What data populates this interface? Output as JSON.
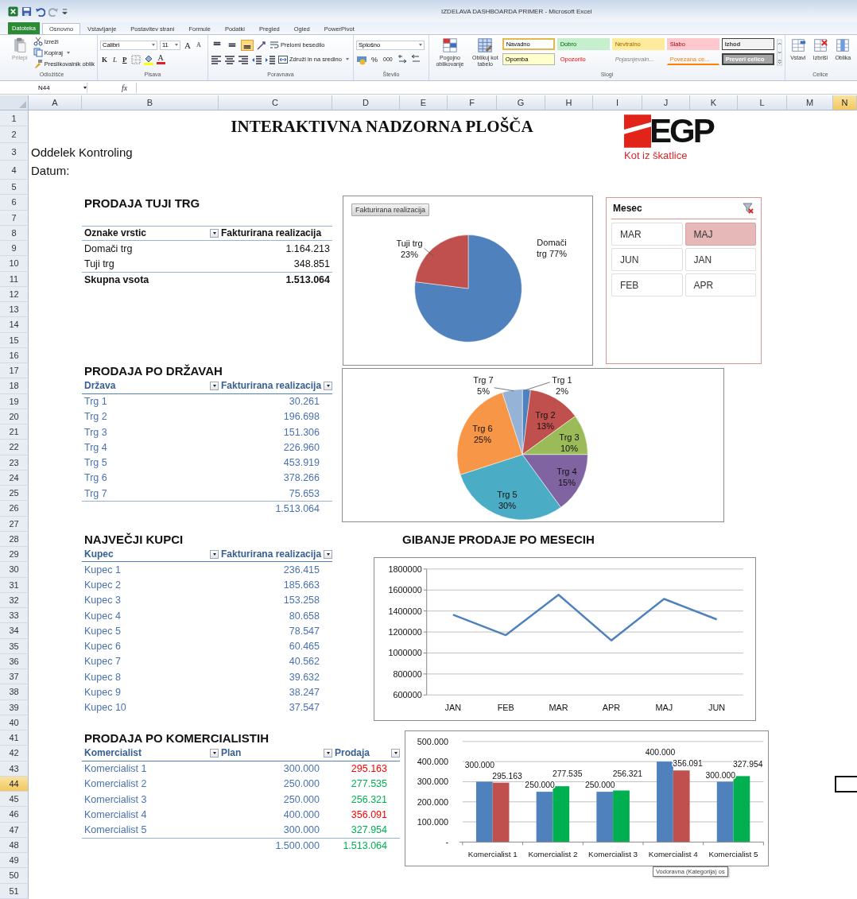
{
  "window": {
    "title": "IZDELAVA DASHBOARDA PRIMER - Microsoft Excel"
  },
  "file_tab": "Datoteka",
  "tabs": [
    {
      "label": "Osnovno",
      "selected": true
    },
    {
      "label": "Vstavljanje",
      "selected": false
    },
    {
      "label": "Postavitev strani",
      "selected": false
    },
    {
      "label": "Formule",
      "selected": false
    },
    {
      "label": "Podatki",
      "selected": false
    },
    {
      "label": "Pregled",
      "selected": false
    },
    {
      "label": "Ogled",
      "selected": false
    },
    {
      "label": "PowerPivot",
      "selected": false
    }
  ],
  "ribbon": {
    "clipboard": {
      "paste": "Prilepi",
      "cut": "Izreži",
      "copy": "Kopiraj",
      "format_painter": "Preslikovalnik oblik",
      "label": "Odložišče"
    },
    "font": {
      "family": "Calibri",
      "size": "11",
      "grow": "A",
      "shrink": "A",
      "bold": "K",
      "italic": "L",
      "underline": "P",
      "color_button": "A",
      "label": "Pisava"
    },
    "alignment": {
      "vertical": [
        {
          "selected": false
        },
        {
          "selected": false
        },
        {
          "selected": true
        }
      ],
      "wrap": "Prelomi besedilo",
      "merge": "Združi in na sredino",
      "label": "Poravnava"
    },
    "number": {
      "format": "Splošno",
      "percent": "%",
      "thousands": "000",
      "label": "Število"
    },
    "styles": {
      "conditional": "Pogojno oblikovanje",
      "as_table": "Oblikuj kot tabelo",
      "label": "Slogi",
      "cell_styles": [
        {
          "label": "Navadno",
          "kind": "normal",
          "selected": true
        },
        {
          "label": "Dobro",
          "kind": "good",
          "selected": false
        },
        {
          "label": "Nevtralno",
          "kind": "neutral",
          "selected": false
        },
        {
          "label": "Slabo",
          "kind": "bad",
          "selected": false
        },
        {
          "label": "Izhod",
          "kind": "output",
          "selected": false
        },
        {
          "label": "Opomba",
          "kind": "note",
          "selected": false
        },
        {
          "label": "Opozorilo",
          "kind": "warning",
          "selected": false
        },
        {
          "label": "Pojasnjevaln...",
          "kind": "explanatory",
          "selected": false
        },
        {
          "label": "Povezana ce...",
          "kind": "linked",
          "selected": false
        },
        {
          "label": "Preveri celico",
          "kind": "check",
          "selected": false
        }
      ]
    },
    "cells": {
      "buttons": [
        "Vstavi",
        "Izbriši",
        "Oblika"
      ],
      "label": "Celice"
    }
  },
  "formula_bar": {
    "name_box": "N44",
    "function_label": "fx"
  },
  "sheet": {
    "columns": [
      {
        "label": "A",
        "selected": false
      },
      {
        "label": "B",
        "selected": false
      },
      {
        "label": "C",
        "selected": false
      },
      {
        "label": "D",
        "selected": false
      },
      {
        "label": "E",
        "selected": false
      },
      {
        "label": "F",
        "selected": false
      },
      {
        "label": "G",
        "selected": false
      },
      {
        "label": "H",
        "selected": false
      },
      {
        "label": "I",
        "selected": false
      },
      {
        "label": "J",
        "selected": false
      },
      {
        "label": "K",
        "selected": false
      },
      {
        "label": "L",
        "selected": false
      },
      {
        "label": "M",
        "selected": false
      },
      {
        "label": "N",
        "selected": true
      }
    ],
    "row_headers": [
      {
        "label": "1",
        "selected": false
      },
      {
        "label": "2",
        "selected": false
      },
      {
        "label": "3",
        "selected": false
      },
      {
        "label": "4",
        "selected": false
      },
      {
        "label": "5",
        "selected": false
      },
      {
        "label": "6",
        "selected": false
      },
      {
        "label": "7",
        "selected": false
      },
      {
        "label": "8",
        "selected": false
      },
      {
        "label": "9",
        "selected": false
      },
      {
        "label": "10",
        "selected": false
      },
      {
        "label": "11",
        "selected": false
      },
      {
        "label": "12",
        "selected": false
      },
      {
        "label": "13",
        "selected": false
      },
      {
        "label": "14",
        "selected": false
      },
      {
        "label": "15",
        "selected": false
      },
      {
        "label": "16",
        "selected": false
      },
      {
        "label": "17",
        "selected": false
      },
      {
        "label": "18",
        "selected": false
      },
      {
        "label": "19",
        "selected": false
      },
      {
        "label": "20",
        "selected": false
      },
      {
        "label": "21",
        "selected": false
      },
      {
        "label": "22",
        "selected": false
      },
      {
        "label": "23",
        "selected": false
      },
      {
        "label": "24",
        "selected": false
      },
      {
        "label": "25",
        "selected": false
      },
      {
        "label": "26",
        "selected": false
      },
      {
        "label": "27",
        "selected": false
      },
      {
        "label": "28",
        "selected": false
      },
      {
        "label": "29",
        "selected": false
      },
      {
        "label": "30",
        "selected": false
      },
      {
        "label": "31",
        "selected": false
      },
      {
        "label": "32",
        "selected": false
      },
      {
        "label": "33",
        "selected": false
      },
      {
        "label": "34",
        "selected": false
      },
      {
        "label": "35",
        "selected": false
      },
      {
        "label": "36",
        "selected": false
      },
      {
        "label": "37",
        "selected": false
      },
      {
        "label": "38",
        "selected": false
      },
      {
        "label": "39",
        "selected": false
      },
      {
        "label": "40",
        "selected": false
      },
      {
        "label": "41",
        "selected": false
      },
      {
        "label": "42",
        "selected": false
      },
      {
        "label": "43",
        "selected": false
      },
      {
        "label": "44",
        "selected": true
      },
      {
        "label": "45",
        "selected": false
      },
      {
        "label": "46",
        "selected": false
      },
      {
        "label": "47",
        "selected": false
      },
      {
        "label": "48",
        "selected": false
      },
      {
        "label": "49",
        "selected": false
      },
      {
        "label": "50",
        "selected": false
      },
      {
        "label": "51",
        "selected": false
      }
    ],
    "title": "INTERAKTIVNA NADZORNA PLOŠČA",
    "department": "Oddelek Kontroling",
    "date_label": "Datum:",
    "logo": {
      "name": "EGP",
      "tagline": "Kot iz škatlice"
    },
    "tables": [
      {
        "kind": "pivot",
        "heading": "PRODAJA TUJI TRG",
        "columns": [
          {
            "label": "Oznake vrstic",
            "filter": true
          },
          {
            "label": "Fakturirana realizacija",
            "filter": false
          }
        ],
        "rows": [
          {
            "cells": [
              "Domači trg",
              "1.164.213"
            ]
          },
          {
            "cells": [
              "Tuji trg",
              "348.851"
            ]
          }
        ],
        "total": {
          "label": "Skupna vsota",
          "values": [
            "1.513.064"
          ]
        }
      },
      {
        "kind": "list",
        "heading": "PRODAJA PO DRŽAVAH",
        "columns": [
          {
            "label": "Država",
            "filter": true
          },
          {
            "label": "Fakturirana realizacija",
            "filter": true
          }
        ],
        "rows": [
          {
            "cells": [
              "Trg 1",
              "30.261"
            ]
          },
          {
            "cells": [
              "Trg 2",
              "196.698"
            ]
          },
          {
            "cells": [
              "Trg 3",
              "151.306"
            ]
          },
          {
            "cells": [
              "Trg 4",
              "226.960"
            ]
          },
          {
            "cells": [
              "Trg 5",
              "453.919"
            ]
          },
          {
            "cells": [
              "Trg 6",
              "378.266"
            ]
          },
          {
            "cells": [
              "Trg 7",
              "75.653"
            ]
          }
        ],
        "total": {
          "values": [
            "1.513.064"
          ]
        }
      },
      {
        "kind": "list",
        "heading": "NAJVEČJI KUPCI",
        "columns": [
          {
            "label": "Kupec",
            "filter": true
          },
          {
            "label": "Fakturirana realizacija",
            "filter": true
          }
        ],
        "rows": [
          {
            "cells": [
              "Kupec 1",
              "236.415"
            ]
          },
          {
            "cells": [
              "Kupec 2",
              "185.663"
            ]
          },
          {
            "cells": [
              "Kupec 3",
              "153.258"
            ]
          },
          {
            "cells": [
              "Kupec 4",
              "80.658"
            ]
          },
          {
            "cells": [
              "Kupec 5",
              "78.547"
            ]
          },
          {
            "cells": [
              "Kupec 6",
              "60.465"
            ]
          },
          {
            "cells": [
              "Kupec 7",
              "40.562"
            ]
          },
          {
            "cells": [
              "Kupec 8",
              "39.632"
            ]
          },
          {
            "cells": [
              "Kupec 9",
              "38.247"
            ]
          },
          {
            "cells": [
              "Kupec 10",
              "37.547"
            ]
          }
        ]
      },
      {
        "kind": "list",
        "heading": "PRODAJA PO KOMERCIALISTIH",
        "columns": [
          {
            "label": "Komercialist",
            "filter": true
          },
          {
            "label": "Plan",
            "filter": true
          },
          {
            "label": "Prodaja",
            "filter": true
          }
        ],
        "rows": [
          {
            "cells": [
              "Komercialist 1",
              "300.000",
              "295.163"
            ],
            "color": "#ff0000"
          },
          {
            "cells": [
              "Komercialist 2",
              "250.000",
              "277.535"
            ],
            "color": "#00b050"
          },
          {
            "cells": [
              "Komercialist 3",
              "250.000",
              "256.321"
            ],
            "color": "#00b050"
          },
          {
            "cells": [
              "Komercialist 4",
              "400.000",
              "356.091"
            ],
            "color": "#ff0000"
          },
          {
            "cells": [
              "Komercialist 5",
              "300.000",
              "327.954"
            ],
            "color": "#00b050"
          }
        ],
        "total": {
          "values": [
            "1.500.000",
            "1.513.064"
          ],
          "color": "#00b050"
        }
      }
    ],
    "charts": [
      {
        "field_button": "Fakturirana realizacija",
        "chart_data": {
          "type": "pie",
          "categories": [
            "Domači trg",
            "Tuji trg"
          ],
          "values": [
            77,
            23
          ],
          "colors": [
            "#4f81bd",
            "#c0504d"
          ],
          "value_labels": [
            "77%",
            "23%"
          ]
        }
      },
      {
        "chart_data": {
          "type": "pie",
          "categories": [
            "Trg 1",
            "Trg 2",
            "Trg 3",
            "Trg 4",
            "Trg 5",
            "Trg 6",
            "Trg 7"
          ],
          "values": [
            2,
            13,
            10,
            15,
            30,
            25,
            5
          ],
          "colors": [
            "#4f81bd",
            "#c0504d",
            "#9bbb59",
            "#8064a2",
            "#4bacc6",
            "#f79646",
            "#95b3d7"
          ],
          "value_labels": [
            "2%",
            "13%",
            "10%",
            "15%",
            "30%",
            "25%",
            "5%"
          ]
        }
      },
      {
        "chart_data": {
          "type": "line",
          "title": "GIBANJE PRODAJE PO MESECIH",
          "categories": [
            "JAN",
            "FEB",
            "MAR",
            "APR",
            "MAJ",
            "JUN"
          ],
          "series": [
            {
              "color": "#4f81bd",
              "values": [
                1365000,
                1170000,
                1555000,
                1120000,
                1515000,
                1320000
              ]
            }
          ],
          "grid": true,
          "ylim": [
            600000,
            1800000
          ],
          "yticks": [
            600000,
            800000,
            1000000,
            1200000,
            1400000,
            1600000,
            1800000
          ]
        }
      },
      {
        "tooltip": "Vodoravna (Kategorija) os",
        "chart_data": {
          "type": "bar",
          "categories": [
            "Komercialist 1",
            "Komercialist 2",
            "Komercialist 3",
            "Komercialist 4",
            "Komercialist 5"
          ],
          "series": [
            {
              "color": "#4f81bd",
              "values": [
                300000,
                250000,
                250000,
                400000,
                300000
              ],
              "value_labels": [
                "300.000",
                "250.000",
                "250.000",
                "400.000",
                "300.000"
              ]
            },
            {
              "colors": [
                "#c0504d",
                "#00b050",
                "#00b050",
                "#c0504d",
                "#00b050"
              ],
              "values": [
                295163,
                277535,
                256321,
                356091,
                327954
              ],
              "value_labels": [
                "295.163",
                "277.535",
                "256.321",
                "356.091",
                "327.954"
              ]
            }
          ],
          "grid": true,
          "ylim": [
            0,
            500000
          ],
          "yticks": [
            {
              "value": 0,
              "label": "-"
            },
            {
              "value": 100000,
              "label": "100.000"
            },
            {
              "value": 200000,
              "label": "200.000"
            },
            {
              "value": 300000,
              "label": "300.000"
            },
            {
              "value": 400000,
              "label": "400.000"
            },
            {
              "value": 500000,
              "label": "500.000"
            }
          ]
        }
      }
    ],
    "slicer": {
      "title": "Mesec",
      "items": [
        {
          "label": "MAR",
          "selected": false
        },
        {
          "label": "MAJ",
          "selected": true
        },
        {
          "label": "JUN",
          "selected": false
        },
        {
          "label": "JAN",
          "selected": false
        },
        {
          "label": "FEB",
          "selected": false
        },
        {
          "label": "APR",
          "selected": false
        }
      ]
    }
  }
}
